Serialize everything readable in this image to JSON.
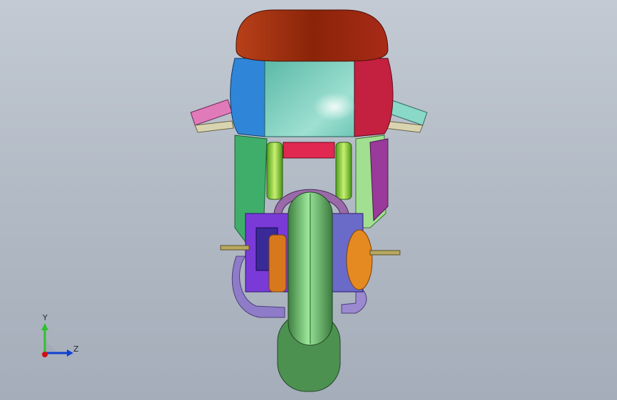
{
  "viewport": {
    "background_top": "#c3cad3",
    "background_bottom": "#a4adb9"
  },
  "model": {
    "colors": {
      "fairing_top": "#9a2a10",
      "fairing_left": "#2f86d8",
      "fairing_center": "#6cc0b0",
      "fairing_right": "#c42040",
      "fork_green": "#7fd03a",
      "tire_green": "#5ea860",
      "frame_green": "#3fae6a",
      "engine_purple": "#7a3ad8",
      "brake_orange": "#e58a20",
      "exhaust_lilac": "#8f7cc8",
      "grip_pink": "#e07ab8",
      "grip_cyan": "#8ad8c8"
    }
  },
  "triad": {
    "y_label": "Y",
    "z_label": "Z",
    "x_color": "#d01010",
    "y_color": "#30c030",
    "z_color": "#1040d0"
  }
}
